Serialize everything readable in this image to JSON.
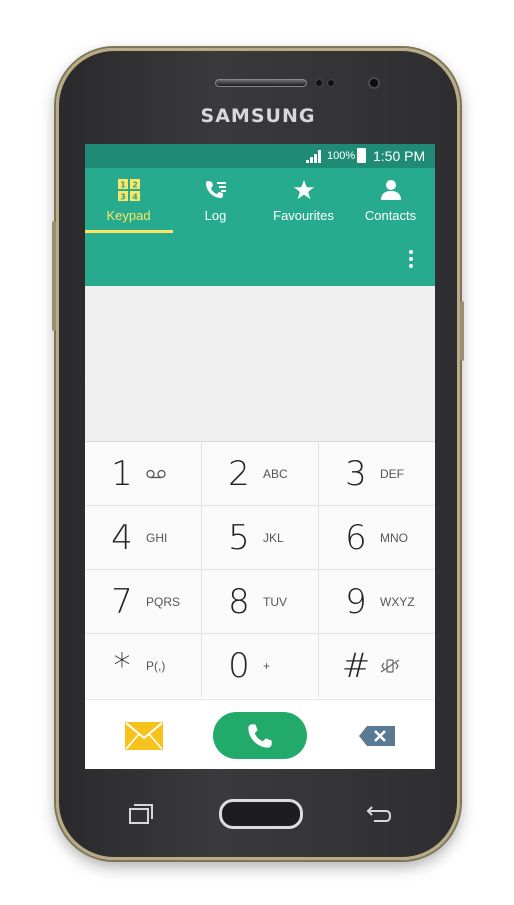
{
  "device": {
    "brand": "SAMSUNG"
  },
  "status_bar": {
    "battery_pct": "100%",
    "time": "1:50 PM"
  },
  "tabs": [
    {
      "label": "Keypad",
      "icon": "keypad-icon",
      "active": true
    },
    {
      "label": "Log",
      "icon": "call-log-icon",
      "active": false
    },
    {
      "label": "Favourites",
      "icon": "star-icon",
      "active": false
    },
    {
      "label": "Contacts",
      "icon": "person-icon",
      "active": false
    }
  ],
  "keypad": {
    "keys": [
      {
        "digit": "1",
        "letters": "",
        "sub_icon": "voicemail-icon"
      },
      {
        "digit": "2",
        "letters": "ABC"
      },
      {
        "digit": "3",
        "letters": "DEF"
      },
      {
        "digit": "4",
        "letters": "GHI"
      },
      {
        "digit": "5",
        "letters": "JKL"
      },
      {
        "digit": "6",
        "letters": "MNO"
      },
      {
        "digit": "7",
        "letters": "PQRS"
      },
      {
        "digit": "8",
        "letters": "TUV"
      },
      {
        "digit": "9",
        "letters": "WXYZ"
      },
      {
        "digit": "*",
        "letters": "P(,)"
      },
      {
        "digit": "0",
        "letters": "+"
      },
      {
        "digit": "#",
        "letters": "",
        "sub_icon": "mute-vibrate-icon"
      }
    ]
  },
  "actions": {
    "message_icon": "envelope-icon",
    "call_icon": "phone-handset-icon",
    "delete_icon": "backspace-icon"
  },
  "colors": {
    "status_bar": "#1f8b75",
    "tab_bar": "#26ab8f",
    "active_tab": "#ffe566",
    "call_button": "#22aa6b",
    "message_icon": "#f7c21b",
    "delete_icon": "#5a7a94"
  }
}
